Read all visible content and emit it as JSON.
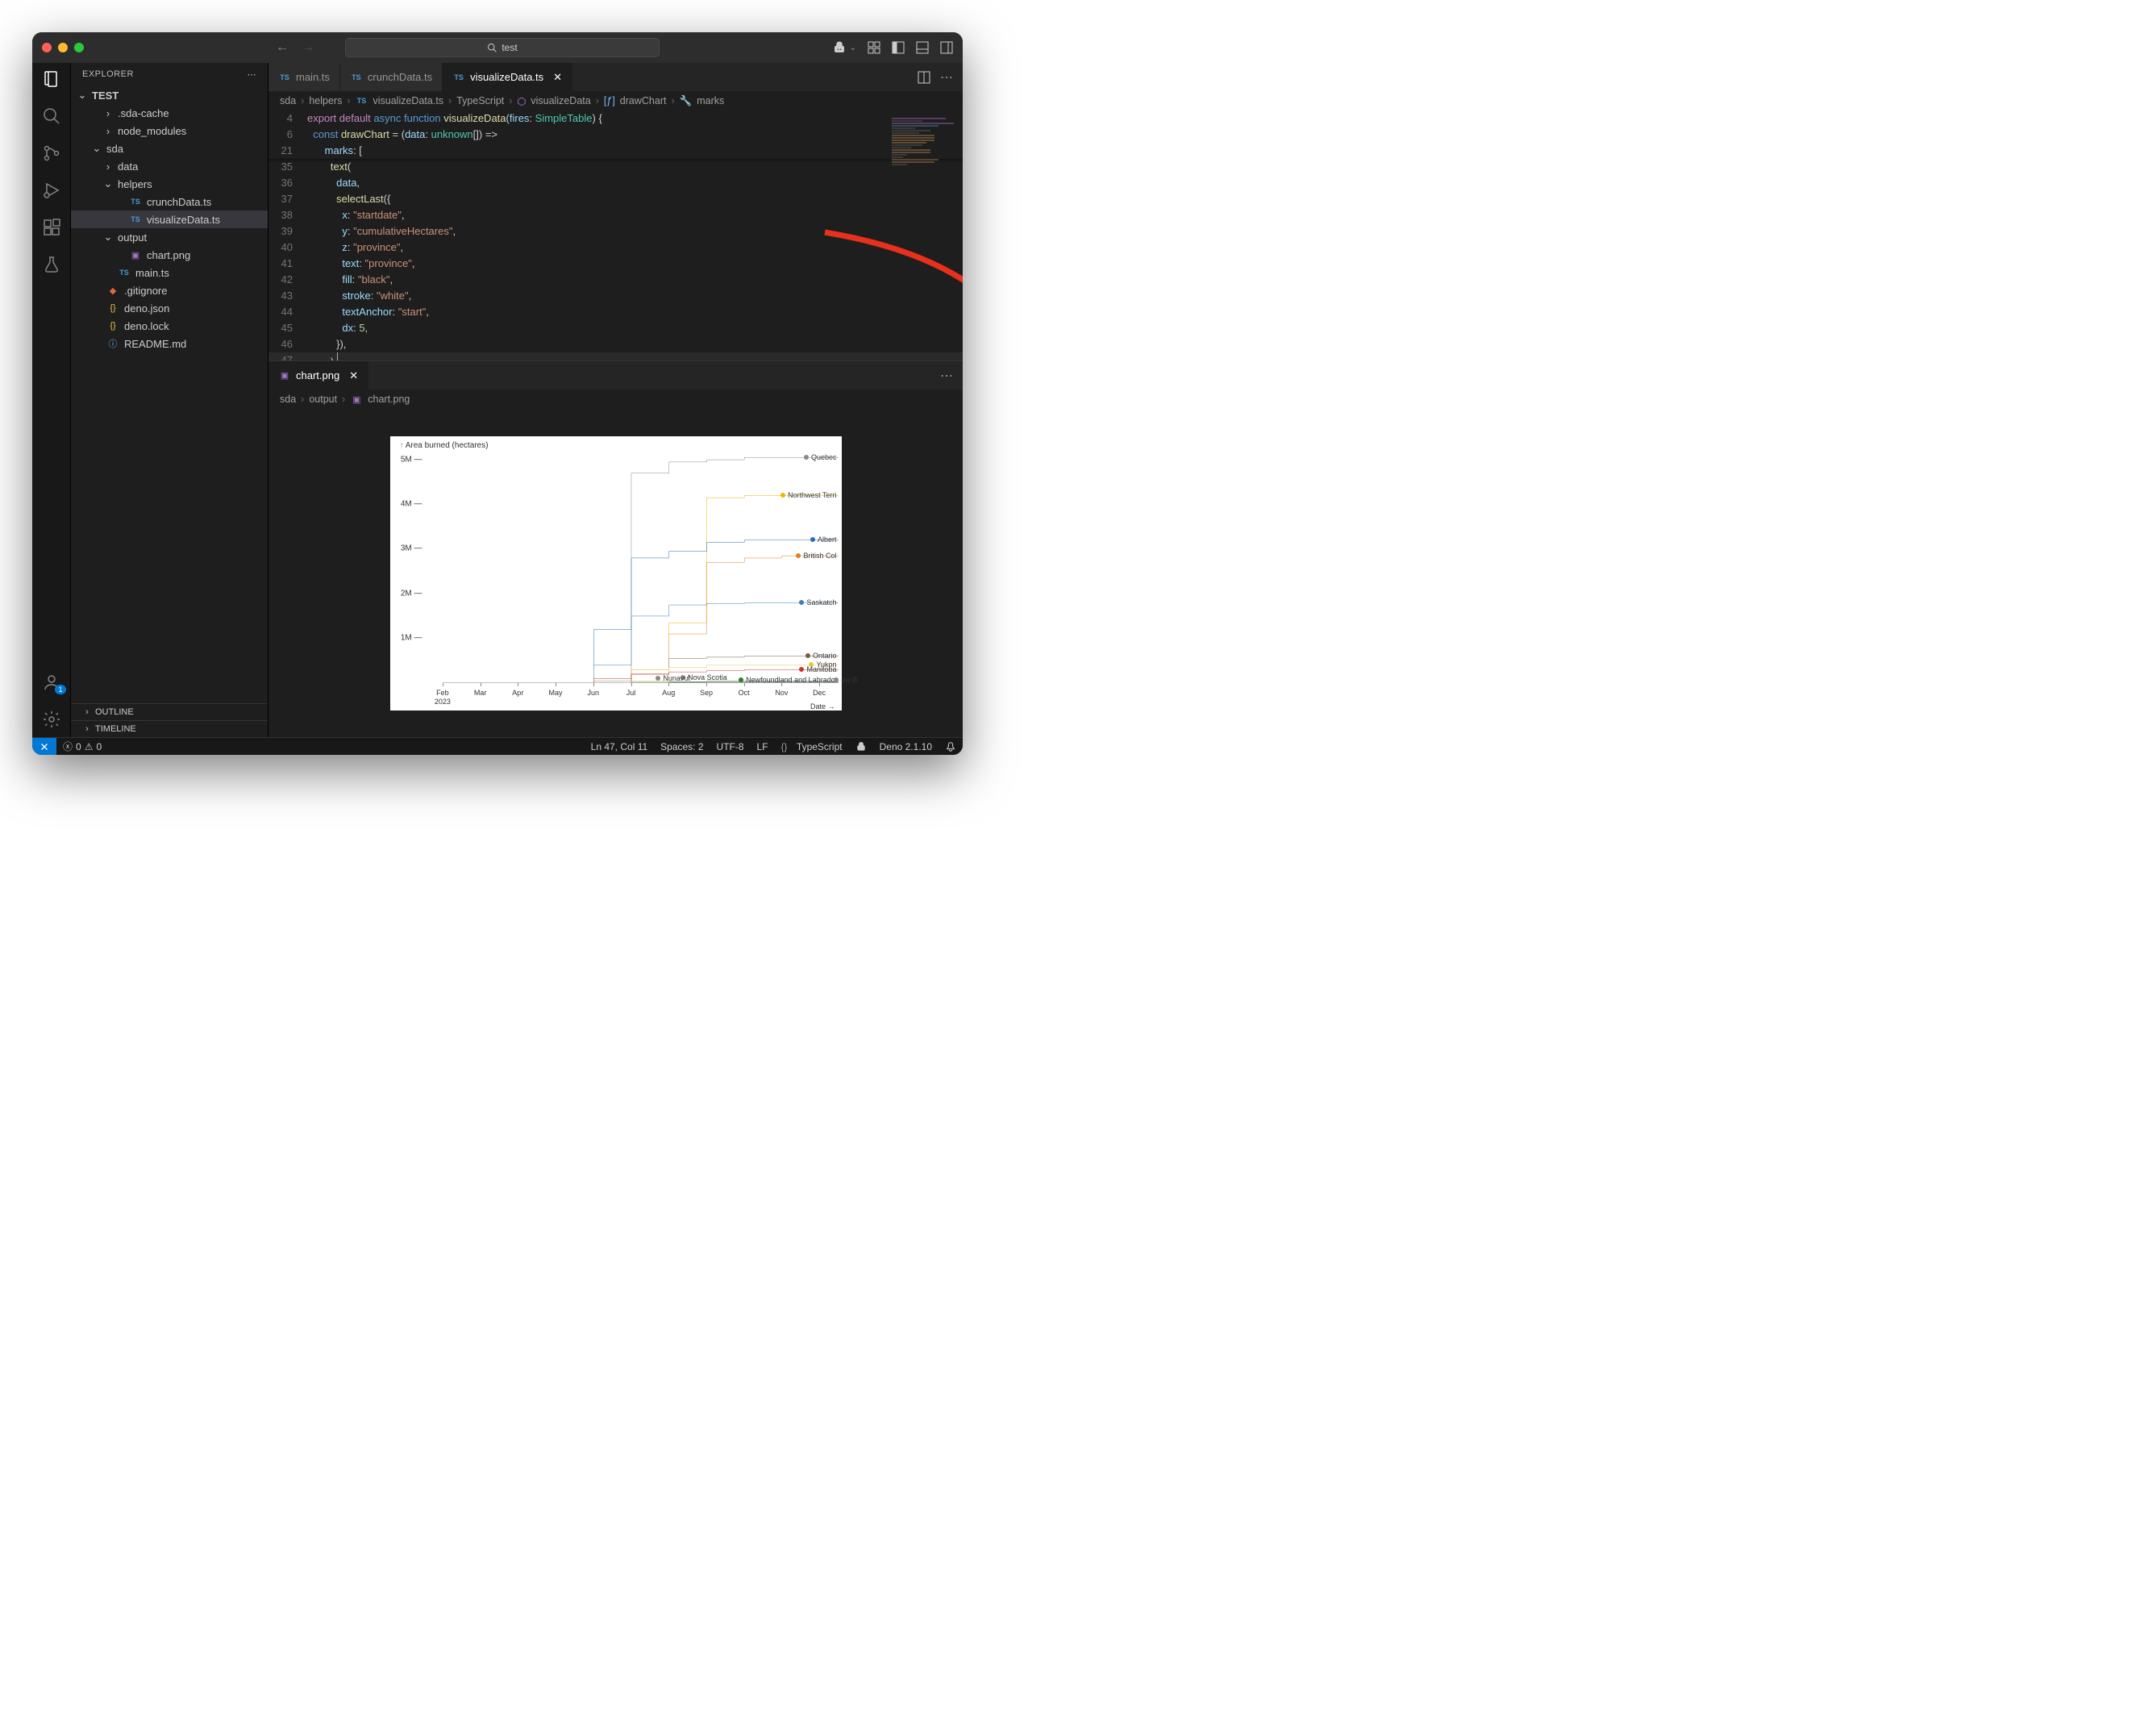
{
  "titlebar": {
    "search_text": "test"
  },
  "sidebar": {
    "header": "EXPLORER",
    "root": "TEST",
    "items": [
      {
        "label": ".sda-cache",
        "indent": 1,
        "chev": "›",
        "icon": ""
      },
      {
        "label": "node_modules",
        "indent": 1,
        "chev": "›",
        "icon": ""
      },
      {
        "label": "sda",
        "indent": 0,
        "chev": "⌄",
        "icon": ""
      },
      {
        "label": "data",
        "indent": 1,
        "chev": "›",
        "icon": ""
      },
      {
        "label": "helpers",
        "indent": 1,
        "chev": "⌄",
        "icon": ""
      },
      {
        "label": "crunchData.ts",
        "indent": 2,
        "chev": "",
        "icon": "TS",
        "cls": "ts"
      },
      {
        "label": "visualizeData.ts",
        "indent": 2,
        "chev": "",
        "icon": "TS",
        "cls": "ts",
        "selected": true
      },
      {
        "label": "output",
        "indent": 1,
        "chev": "⌄",
        "icon": ""
      },
      {
        "label": "chart.png",
        "indent": 2,
        "chev": "",
        "icon": "▣",
        "cls": "img"
      },
      {
        "label": "main.ts",
        "indent": 1,
        "chev": "",
        "icon": "TS",
        "cls": "ts"
      },
      {
        "label": ".gitignore",
        "indent": 0,
        "chev": "",
        "icon": "◆",
        "cls": "git"
      },
      {
        "label": "deno.json",
        "indent": 0,
        "chev": "",
        "icon": "{}",
        "cls": "jsn"
      },
      {
        "label": "deno.lock",
        "indent": 0,
        "chev": "",
        "icon": "{}",
        "cls": "jsn"
      },
      {
        "label": "README.md",
        "indent": 0,
        "chev": "",
        "icon": "ⓘ",
        "cls": "info"
      }
    ],
    "outline": "OUTLINE",
    "timeline": "TIMELINE"
  },
  "tabs": {
    "t1": "main.ts",
    "t2": "crunchData.ts",
    "t3": "visualizeData.ts"
  },
  "breadcrumbs": {
    "p1": "sda",
    "p2": "helpers",
    "p3": "visualizeData.ts",
    "p4": "TypeScript",
    "p5": "visualizeData",
    "p6": "drawChart",
    "p7": "marks"
  },
  "code": {
    "l4a": "export",
    "l4b": "default",
    "l4c": "async",
    "l4d": "function",
    "l4e": "visualizeData",
    "l4f": "fires",
    "l4g": "SimpleTable",
    "l6a": "const",
    "l6b": "drawChart",
    "l6c": "data",
    "l6d": "unknown",
    "l21a": "marks",
    "l35a": "text",
    "l36a": "data",
    "l37a": "selectLast",
    "l38a": "x",
    "l38b": "\"startdate\"",
    "l39a": "y",
    "l39b": "\"cumulativeHectares\"",
    "l40a": "z",
    "l40b": "\"province\"",
    "l41a": "text",
    "l41b": "\"province\"",
    "l42a": "fill",
    "l42b": "\"black\"",
    "l43a": "stroke",
    "l43b": "\"white\"",
    "l44a": "textAnchor",
    "l44b": "\"start\"",
    "l45a": "dx",
    "l45b": "5",
    "lines": {
      "n4": "4",
      "n6": "6",
      "n21": "21",
      "n35": "35",
      "n36": "36",
      "n37": "37",
      "n38": "38",
      "n39": "39",
      "n40": "40",
      "n41": "41",
      "n42": "42",
      "n43": "43",
      "n44": "44",
      "n45": "45",
      "n46": "46",
      "n47": "47"
    }
  },
  "secondary": {
    "tab": "chart.png",
    "crumb1": "sda",
    "crumb2": "output",
    "crumb3": "chart.png"
  },
  "statusbar": {
    "errors": "0",
    "warnings": "0",
    "lncol": "Ln 47, Col 11",
    "spaces": "Spaces: 2",
    "enc": "UTF-8",
    "eol": "LF",
    "lang": "TypeScript",
    "runtime": "Deno 2.1.10"
  },
  "chart_data": {
    "type": "line",
    "title": "Area burned (hectares)",
    "xlabel": "Date →",
    "year": "2023",
    "x": [
      "Feb",
      "Mar",
      "Apr",
      "May",
      "Jun",
      "Jul",
      "Aug",
      "Sep",
      "Oct",
      "Nov",
      "Dec"
    ],
    "ylim": [
      0,
      5200000
    ],
    "y_ticks": [
      "1M",
      "2M",
      "3M",
      "4M",
      "5M"
    ],
    "y_tick_values": [
      1000000,
      2000000,
      3000000,
      4000000,
      5000000
    ],
    "series": [
      {
        "name": "Quebec",
        "color": "#888888",
        "values": [
          0,
          0,
          0,
          0,
          50000,
          4700000,
          4950000,
          5000000,
          5050000,
          5050000,
          5050000,
          5050000
        ]
      },
      {
        "name": "Northwest Terri",
        "color": "#e6b800",
        "values": [
          0,
          0,
          0,
          0,
          0,
          300000,
          1350000,
          4150000,
          4200000,
          4200000,
          4200000,
          4200000
        ]
      },
      {
        "name": "Albert",
        "color": "#2a6db0",
        "values": [
          0,
          0,
          0,
          0,
          1200000,
          2800000,
          2950000,
          3150000,
          3200000,
          3200000,
          3200000,
          3200000
        ]
      },
      {
        "name": "British Col",
        "color": "#e67e22",
        "values": [
          0,
          0,
          0,
          0,
          0,
          200000,
          1100000,
          2700000,
          2800000,
          2850000,
          2850000,
          2850000
        ]
      },
      {
        "name": "Saskatch",
        "color": "#3a7db8",
        "values": [
          0,
          0,
          0,
          0,
          400000,
          1500000,
          1750000,
          1780000,
          1800000,
          1800000,
          1800000,
          1800000
        ]
      },
      {
        "name": "Ontario",
        "color": "#7a5c3e",
        "values": [
          0,
          0,
          0,
          0,
          0,
          200000,
          550000,
          580000,
          600000,
          600000,
          600000,
          600000
        ]
      },
      {
        "name": "Yukon",
        "color": "#e0c84a",
        "values": [
          0,
          0,
          0,
          0,
          0,
          50000,
          350000,
          400000,
          400000,
          400000,
          400000,
          400000
        ]
      },
      {
        "name": "Manitoba",
        "color": "#c0392b",
        "values": [
          0,
          0,
          0,
          0,
          100000,
          200000,
          250000,
          280000,
          300000,
          300000,
          300000,
          300000
        ]
      },
      {
        "name": "Nova Scotia",
        "color": "#888",
        "values": [
          0,
          0,
          0,
          0,
          0,
          20000,
          25000,
          25000,
          25000,
          25000,
          25000,
          25000
        ]
      },
      {
        "name": "Nunavut",
        "color": "#888",
        "values": [
          0,
          0,
          0,
          0,
          0,
          0,
          10000,
          10000,
          10000,
          10000,
          10000,
          10000
        ]
      },
      {
        "name": "Newfoundland and Labrador",
        "color": "#2e7d32",
        "values": [
          0,
          0,
          0,
          0,
          0,
          0,
          30000,
          40000,
          40000,
          40000,
          40000,
          40000
        ]
      },
      {
        "name": "ew B",
        "color": "#888",
        "values": [
          0,
          0,
          0,
          0,
          0,
          0,
          5000,
          5000,
          5000,
          5000,
          5000,
          5000
        ]
      }
    ],
    "label_positions": [
      {
        "name": "Quebec",
        "y": 5050000
      },
      {
        "name": "Northwest Terri",
        "y": 4200000
      },
      {
        "name": "Albert",
        "y": 3200000
      },
      {
        "name": "British Col",
        "y": 2850000
      },
      {
        "name": "Saskatch",
        "y": 1800000
      },
      {
        "name": "Ontario",
        "y": 600000
      },
      {
        "name": "Yukon",
        "y": 400000
      },
      {
        "name": "Manitoba",
        "y": 300000
      },
      {
        "name": "Nova Scotia",
        "y": 120000,
        "x": 0.62
      },
      {
        "name": "Nunavut",
        "y": 100000,
        "x": 0.56
      },
      {
        "name": "Newfoundland and Labrador",
        "y": 70000,
        "x": 0.76
      },
      {
        "name": "ew B",
        "y": 70000,
        "x": 0.99
      }
    ]
  }
}
